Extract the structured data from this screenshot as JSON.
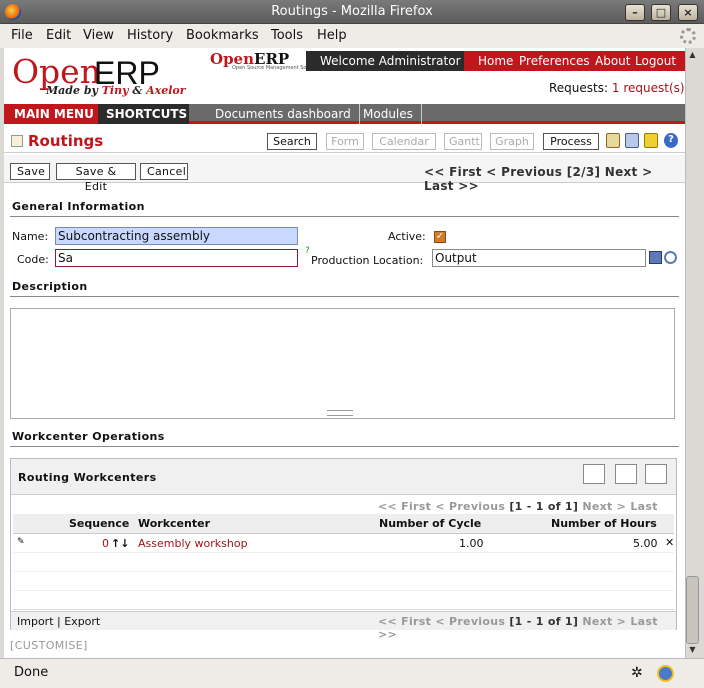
{
  "window": {
    "title": "Routings - Mozilla Firefox"
  },
  "menubar": {
    "file": "File",
    "edit": "Edit",
    "view": "View",
    "history": "History",
    "bookmarks": "Bookmarks",
    "tools": "Tools",
    "help": "Help"
  },
  "header": {
    "logo_open": "Open",
    "logo_erp": "ERP",
    "logo_tagline": "Made by",
    "logo_tiny": "Tiny",
    "logo_amp": "&",
    "logo_axelor": "Axelor",
    "logo2_open": "Open",
    "logo2_erp": "ERP",
    "logo2_tagline": "Open Source Management Solution",
    "welcome": "Welcome Administrator",
    "links": {
      "home": "Home",
      "preferences": "Preferences",
      "about": "About",
      "logout": "Logout"
    },
    "requests_label": "Requests:",
    "requests_value": "1 request(s)"
  },
  "nav": {
    "main_menu": "MAIN MENU",
    "shortcuts": "SHORTCUTS",
    "dashboard": "Documents dashboard",
    "modules": "Modules"
  },
  "view": {
    "title": "Routings",
    "buttons": {
      "search": "Search",
      "form": "Form",
      "calendar": "Calendar",
      "gantt": "Gantt",
      "graph": "Graph",
      "process": "Process"
    }
  },
  "actions": {
    "save": "Save",
    "save_edit": "Save & Edit",
    "cancel": "Cancel",
    "pager": "<< First < Previous [2/3] Next > Last >>"
  },
  "form": {
    "general_title": "General Information",
    "name_label": "Name:",
    "name_value": "Subcontracting assembly",
    "active_label": "Active:",
    "active_checked": true,
    "code_label": "Code:",
    "code_value": "Sa",
    "help_mark": "?",
    "location_label": "Production Location:",
    "location_value": "Output",
    "description_title": "Description",
    "workcenter_title": "Workcenter Operations"
  },
  "grid": {
    "title": "Routing Workcenters",
    "pager_first": "<< First",
    "pager_prev": "< Previous",
    "pager_range": "[1 - 1 of 1]",
    "pager_next": "Next >",
    "pager_last": "Last >>",
    "columns": {
      "sequence": "Sequence",
      "workcenter": "Workcenter",
      "cycles": "Number of Cycle",
      "hours": "Number of Hours"
    },
    "rows": [
      {
        "sequence": "0",
        "arrows": "↑↓",
        "workcenter": "Assembly workshop",
        "cycles": "1.00",
        "hours": "5.00"
      }
    ],
    "import": "Import",
    "pipe": "|",
    "export": "Export"
  },
  "customise": "[CUSTOMISE]",
  "status": {
    "text": "Done"
  },
  "colors": {
    "accent_red": "#c0161c",
    "dark": "#2b2b2b",
    "name_bg": "#c8d8ff"
  }
}
